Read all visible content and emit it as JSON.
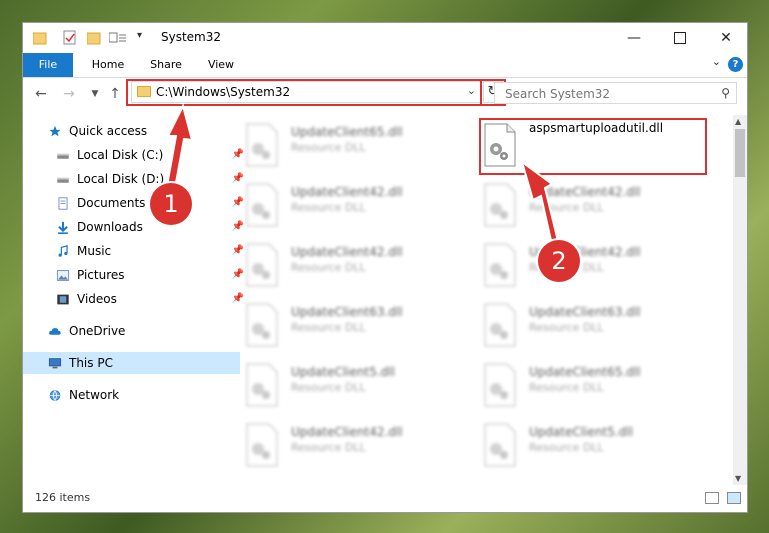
{
  "window": {
    "title": "System32"
  },
  "titlebar": {
    "minimize_icon": "minimize-icon",
    "maximize_icon": "maximize-icon",
    "close_icon": "close-icon"
  },
  "ribbon": {
    "tabs": [
      {
        "label": "File"
      },
      {
        "label": "Home"
      },
      {
        "label": "Share"
      },
      {
        "label": "View"
      }
    ],
    "help": "?"
  },
  "nav": {
    "address": "C:\\Windows\\System32",
    "search_placeholder": "Search System32"
  },
  "sidebar": {
    "items": [
      {
        "label": "Quick access",
        "icon": "star-icon"
      },
      {
        "label": "Local Disk (C:)",
        "icon": "drive-icon",
        "pinned": true
      },
      {
        "label": "Local Disk (D:)",
        "icon": "drive-icon",
        "pinned": true
      },
      {
        "label": "Documents",
        "icon": "documents-icon",
        "pinned": true
      },
      {
        "label": "Downloads",
        "icon": "download-icon",
        "pinned": true
      },
      {
        "label": "Music",
        "icon": "music-icon",
        "pinned": true
      },
      {
        "label": "Pictures",
        "icon": "pictures-icon",
        "pinned": true
      },
      {
        "label": "Videos",
        "icon": "videos-icon",
        "pinned": true
      },
      {
        "label": "OneDrive",
        "icon": "cloud-icon"
      },
      {
        "label": "This PC",
        "icon": "computer-icon",
        "selected": true
      },
      {
        "label": "Network",
        "icon": "network-icon"
      }
    ]
  },
  "files": {
    "left_column": [
      {
        "name": "UpdateClient65.dll",
        "type": "Resource DLL"
      },
      {
        "name": "UpdateClient42.dll",
        "type": "Resource DLL"
      },
      {
        "name": "UpdateClient42.dll",
        "type": "Resource DLL"
      },
      {
        "name": "UpdateClient63.dll",
        "type": "Resource DLL"
      },
      {
        "name": "UpdateClient5.dll",
        "type": "Resource DLL"
      },
      {
        "name": "UpdateClient42.dll",
        "type": "Resource DLL"
      }
    ],
    "right_column": [
      {
        "name": "aspsmartuploadutil.dll",
        "type": "",
        "focused": true
      },
      {
        "name": "UpdateClient42.dll",
        "type": "Resource DLL"
      },
      {
        "name": "UpdateClient42.dll",
        "type": "Resource DLL"
      },
      {
        "name": "UpdateClient63.dll",
        "type": "Resource DLL"
      },
      {
        "name": "UpdateClient65.dll",
        "type": "Resource DLL"
      },
      {
        "name": "UpdateClient5.dll",
        "type": "Resource DLL"
      }
    ]
  },
  "status": {
    "item_count": "126 items"
  },
  "annotations": {
    "step1": "1",
    "step2": "2",
    "color": "#d9322f"
  },
  "colors": {
    "accent": "#1979ca",
    "selected_bg": "#cce8ff"
  }
}
